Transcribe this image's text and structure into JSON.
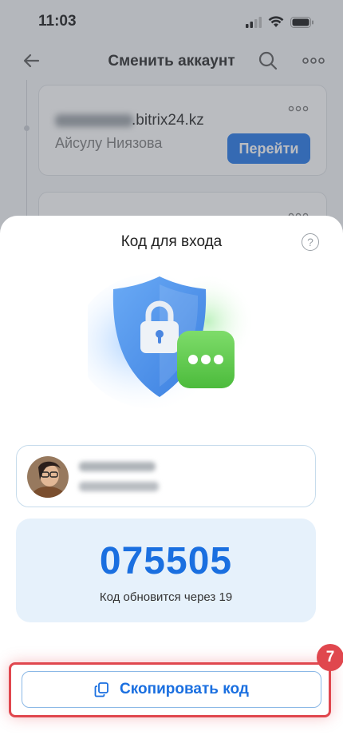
{
  "status_bar": {
    "time": "11:03"
  },
  "header": {
    "title": "Сменить аккаунт"
  },
  "account": {
    "domain": ".bitrix24.kz",
    "name": "Айсулу Ниязова",
    "go_label": "Перейти"
  },
  "sheet": {
    "title": "Код для входа",
    "help_glyph": "?",
    "code": "075505",
    "timer_text": "Код обновится через 19",
    "copy_label": "Скопировать код",
    "step_number": "7"
  },
  "colors": {
    "accent": "#1a73e8",
    "code_text": "#1a6fe0",
    "code_bg": "#e6f1fb",
    "highlight": "#e0474e"
  },
  "icons": [
    "back-arrow-icon",
    "search-icon",
    "more-icon",
    "help-icon",
    "lock-shield-icon",
    "copy-icon"
  ]
}
